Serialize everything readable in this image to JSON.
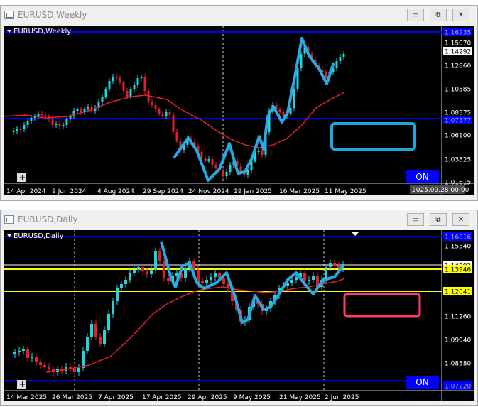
{
  "windows": {
    "weekly": {
      "title": "EURUSD,Weekly",
      "chart_label": "EURUSD,Weekly",
      "on_label": "ON",
      "time_label": "2025.09.28 00:00",
      "price_labels": [
        "1.16235",
        "1.15070",
        "1.14292",
        "1.12860",
        "1.10585",
        "1.08375",
        "1.07377",
        "1.06100",
        "1.03825",
        "1.01615"
      ],
      "current_price": "1.14292",
      "date_labels": [
        "14 Apr 2024",
        "9 Jun 2024",
        "4 Aug 2024",
        "29 Sep 2024",
        "24 Nov 2024",
        "19 Jan 2025",
        "16 Mar 2025",
        "11 May 2025"
      ]
    },
    "daily": {
      "title": "EURUSD,Daily",
      "chart_label": "EURUSD,Daily",
      "on_label": "ON",
      "price_labels": [
        "1.16016",
        "1.15340",
        "1.14292",
        "1.13946",
        "1.12641",
        "1.11260",
        "1.09940",
        "1.08580",
        "1.07220"
      ],
      "current_price": "1.14292",
      "level_price": "1.13946",
      "level_price_2": "1.12641",
      "date_labels": [
        "14 Mar 2025",
        "26 Mar 2025",
        "7 Apr 2025",
        "17 Apr 2025",
        "29 Apr 2025",
        "9 May 2025",
        "21 May 2025",
        "2 Jun 2025"
      ]
    }
  },
  "buttons": {
    "minimize": "▭",
    "restore": "⧉",
    "close": "✕"
  },
  "colors": {
    "background": "#000000",
    "bull_candle": "#1fd6e0",
    "bear_candle": "#e0202a",
    "moving_average": "#e0202a",
    "trend_line": "#29a9e0",
    "blue_line": "#0000ff",
    "yellow_line": "#ffff00",
    "weekly_box": "#1ba9e0",
    "daily_box": "#ff3a6a"
  }
}
